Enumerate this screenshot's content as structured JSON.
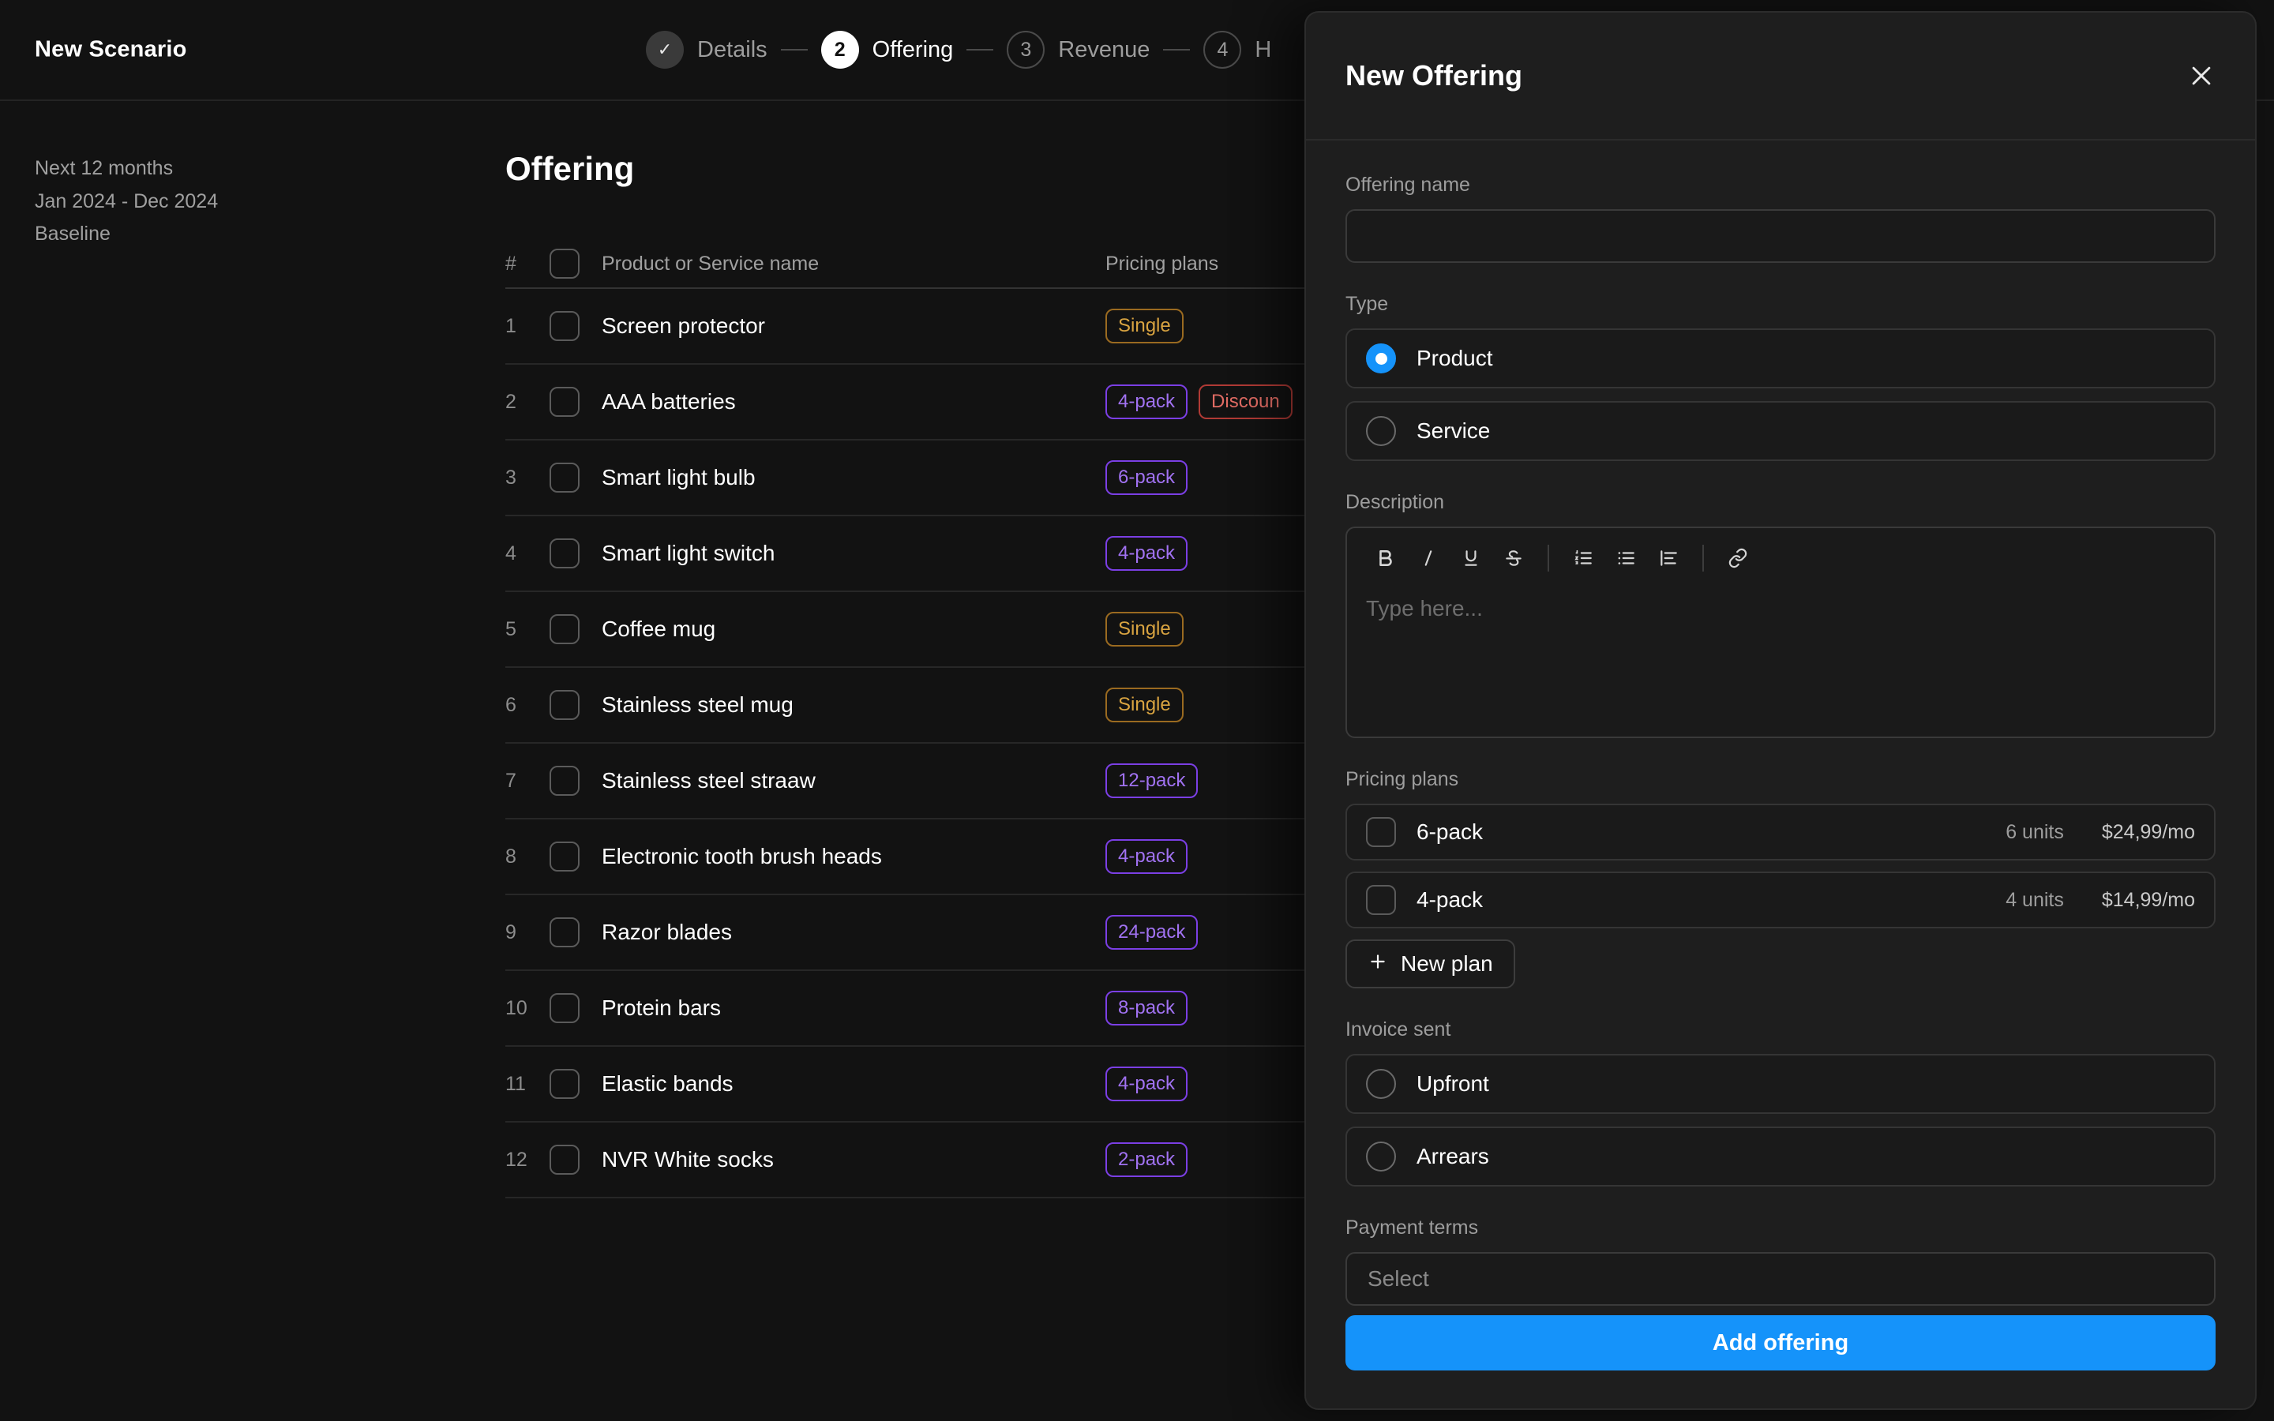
{
  "topbar": {
    "brand": "New Scenario",
    "steps": [
      {
        "bubble": "✓",
        "label": "Details",
        "state": "done"
      },
      {
        "bubble": "2",
        "label": "Offering",
        "state": "active"
      },
      {
        "bubble": "3",
        "label": "Revenue",
        "state": "idle"
      },
      {
        "bubble": "4",
        "label": "H",
        "state": "idle"
      }
    ]
  },
  "meta": {
    "range_label": "Next 12 months",
    "range_dates": "Jan 2024 - Dec 2024",
    "scenario": "Baseline"
  },
  "main": {
    "title": "Offering",
    "columns": {
      "index": "#",
      "name": "Product or Service name",
      "plans": "Pricing plans"
    },
    "rows": [
      {
        "idx": "1",
        "name": "Screen protector",
        "plans": [
          {
            "label": "Single",
            "color": "amber"
          }
        ]
      },
      {
        "idx": "2",
        "name": "AAA batteries",
        "plans": [
          {
            "label": "4-pack",
            "color": "purple"
          },
          {
            "label": "Discoun",
            "color": "red"
          }
        ]
      },
      {
        "idx": "3",
        "name": "Smart light bulb",
        "plans": [
          {
            "label": "6-pack",
            "color": "purple"
          }
        ]
      },
      {
        "idx": "4",
        "name": "Smart light switch",
        "plans": [
          {
            "label": "4-pack",
            "color": "purple"
          }
        ]
      },
      {
        "idx": "5",
        "name": "Coffee mug",
        "plans": [
          {
            "label": "Single",
            "color": "amber"
          }
        ]
      },
      {
        "idx": "6",
        "name": "Stainless steel mug",
        "plans": [
          {
            "label": "Single",
            "color": "amber"
          }
        ]
      },
      {
        "idx": "7",
        "name": "Stainless steel straaw",
        "plans": [
          {
            "label": "12-pack",
            "color": "purple"
          }
        ]
      },
      {
        "idx": "8",
        "name": "Electronic tooth brush heads",
        "plans": [
          {
            "label": "4-pack",
            "color": "purple"
          }
        ]
      },
      {
        "idx": "9",
        "name": "Razor blades",
        "plans": [
          {
            "label": "24-pack",
            "color": "purple"
          }
        ]
      },
      {
        "idx": "10",
        "name": "Protein bars",
        "plans": [
          {
            "label": "8-pack",
            "color": "purple"
          }
        ]
      },
      {
        "idx": "11",
        "name": "Elastic bands",
        "plans": [
          {
            "label": "4-pack",
            "color": "purple"
          }
        ]
      },
      {
        "idx": "12",
        "name": "NVR White socks",
        "plans": [
          {
            "label": "2-pack",
            "color": "purple"
          }
        ]
      }
    ]
  },
  "panel": {
    "title": "New Offering",
    "close_icon": "close-icon",
    "offering_name": {
      "label": "Offering name",
      "value": "",
      "placeholder": ""
    },
    "type": {
      "label": "Type",
      "options": [
        {
          "label": "Product",
          "selected": true
        },
        {
          "label": "Service",
          "selected": false
        }
      ]
    },
    "description": {
      "label": "Description",
      "placeholder": "Type here...",
      "value": "",
      "toolbar": [
        {
          "name": "bold-icon",
          "glyph": "B"
        },
        {
          "name": "italic-icon",
          "glyph": "I"
        },
        {
          "name": "underline-icon",
          "glyph": "U"
        },
        {
          "name": "strikethrough-icon",
          "glyph": "S"
        },
        {
          "name": "ordered-list-icon",
          "glyph": ""
        },
        {
          "name": "bulleted-list-icon",
          "glyph": ""
        },
        {
          "name": "indent-icon",
          "glyph": ""
        },
        {
          "name": "link-icon",
          "glyph": ""
        }
      ]
    },
    "pricing_plans": {
      "label": "Pricing plans",
      "plans": [
        {
          "name": "6-pack",
          "units": "6 units",
          "price": "$24,99/mo",
          "checked": false
        },
        {
          "name": "4-pack",
          "units": "4 units",
          "price": "$14,99/mo",
          "checked": false
        }
      ],
      "new_plan_label": "New plan",
      "new_plan_icon": "plus-icon"
    },
    "invoice_sent": {
      "label": "Invoice sent",
      "options": [
        {
          "label": "Upfront",
          "selected": false
        },
        {
          "label": "Arrears",
          "selected": false
        }
      ]
    },
    "payment_terms": {
      "label": "Payment terms",
      "value": "Select"
    },
    "submit_label": "Add offering"
  },
  "colors": {
    "page_bg": "#121212",
    "panel_bg": "#1e1e1e",
    "accent": "#1593fa",
    "badge_purple": "#a172f2",
    "badge_amber": "#d9a441",
    "badge_red": "#e06b63"
  }
}
